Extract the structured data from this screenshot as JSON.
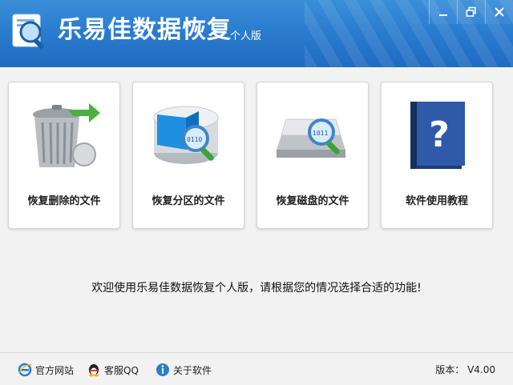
{
  "app": {
    "title": "乐易佳数据恢复",
    "edition": "个人版"
  },
  "window_controls": [
    "minimize",
    "maximize",
    "close"
  ],
  "cards": [
    {
      "label": "恢复删除的文件",
      "icon": "trash-bin-icon"
    },
    {
      "label": "恢复分区的文件",
      "icon": "partition-disk-icon"
    },
    {
      "label": "恢复磁盘的文件",
      "icon": "hard-drive-icon"
    },
    {
      "label": "软件使用教程",
      "icon": "help-book-icon"
    }
  ],
  "welcome_text": "欢迎使用乐易佳数据恢复个人版，请根据您的情况选择合适的功能!",
  "footer": {
    "links": [
      {
        "label": "官方网站",
        "icon": "browser-icon"
      },
      {
        "label": "客服QQ",
        "icon": "qq-icon"
      },
      {
        "label": "关于软件",
        "icon": "info-icon"
      }
    ],
    "version": "版本： V4.00"
  },
  "colors": {
    "header": "#2b7ccf",
    "background": "#f2f2f2"
  }
}
